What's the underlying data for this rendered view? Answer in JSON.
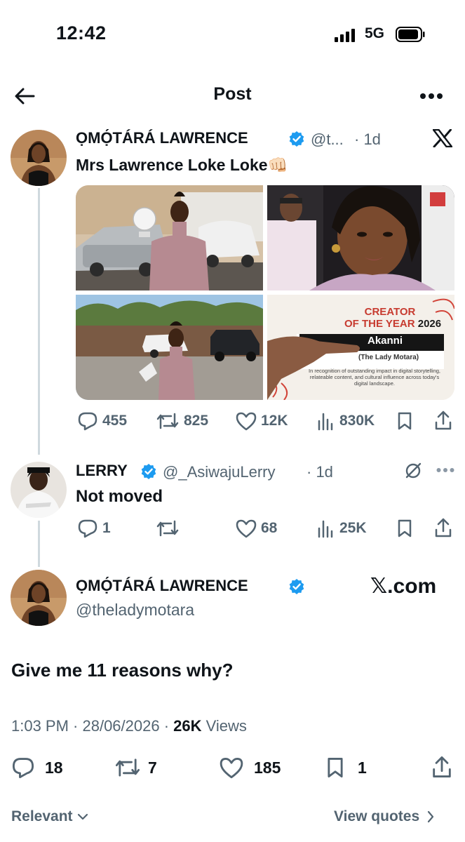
{
  "status_bar": {
    "time": "12:42",
    "network": "5G"
  },
  "header": {
    "title": "Post"
  },
  "post1": {
    "name": "ỌMỌ́TÁRÁ LAWRENCE",
    "handle": "@t...",
    "age": "· 1d",
    "text": "Mrs Lawrence Loke Loke👊🏻",
    "card_heading_1": "CREATOR",
    "card_heading_2": "OF THE YEAR",
    "card_year": "2026",
    "card_name": "Akanni",
    "card_subname": "(The Lady Motara)",
    "card_body": "In recognition of outstanding impact in digital storytelling, relateable content, and cultural influence across today's digital landscape.",
    "stats": {
      "replies": "455",
      "reposts": "825",
      "likes": "12K",
      "views": "830K"
    }
  },
  "post2": {
    "name": "LERRY",
    "handle": "@_AsiwajuLerry",
    "age": "· 1d",
    "text": "Not moved",
    "stats": {
      "replies": "1",
      "reposts": "",
      "likes": "68",
      "views": "25K"
    }
  },
  "main_post": {
    "name": "ỌMỌ́TÁRÁ LAWRENCE",
    "handle": "@theladymotara",
    "watermark": "𝕏.com",
    "text": "Give me 11 reasons why?",
    "timestamp": "1:03 PM · 28/06/2026 ·",
    "views_count": "26K",
    "views_label": "Views",
    "stats": {
      "replies": "18",
      "reposts": "7",
      "likes": "185",
      "bookmarks": "1"
    }
  },
  "footer": {
    "sort_label": "Relevant",
    "view_quotes": "View quotes"
  },
  "colors": {
    "verified": "#1d9bf0",
    "text": "#0f1419",
    "muted": "#536471"
  }
}
